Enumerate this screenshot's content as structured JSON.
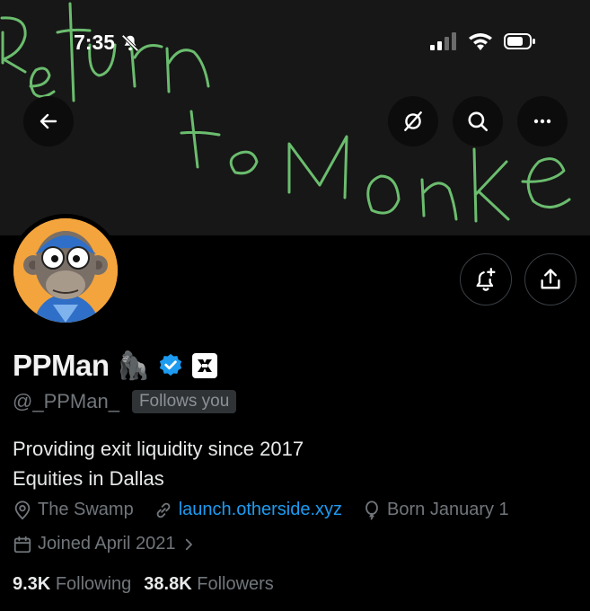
{
  "status_bar": {
    "time": "7:35"
  },
  "banner": {
    "handwriting_lines": [
      "Return",
      "to Monke"
    ]
  },
  "profile": {
    "display_name": "PPMan",
    "emoji": "🦍",
    "handle": "@_PPMan_",
    "follows_you": "Follows you",
    "bio_lines": [
      "Providing exit liquidity since 2017",
      "Equities in Dallas"
    ],
    "location": "The Swamp",
    "website": "launch.otherside.xyz",
    "birthday": "Born January 1",
    "joined": "Joined April 2021",
    "following_count": "9.3K",
    "following_label": "Following",
    "followers_count": "38.8K",
    "followers_label": "Followers"
  },
  "colors": {
    "accent_link": "#1d9bf0",
    "verified": "#1d9bf0",
    "muted_text": "#71767b",
    "avatar_bg": "#f4a43c",
    "scribble": "#6bbd6e"
  },
  "icons": [
    "back-arrow-icon",
    "grok-icon",
    "search-icon",
    "more-icon",
    "notification-bell-icon",
    "share-icon",
    "verified-badge-icon",
    "affiliate-icon",
    "location-icon",
    "link-icon",
    "balloon-icon",
    "calendar-icon",
    "chevron-right-icon"
  ]
}
